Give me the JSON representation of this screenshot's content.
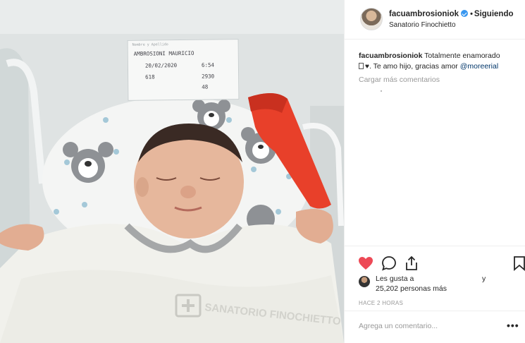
{
  "post": {
    "username": "facuambrosioniok",
    "follow_separator": "•",
    "follow_status": "Siguiendo",
    "location": "Sanatorio Finochietto",
    "caption": {
      "author": "facuambrosioniok",
      "text_1": "Totalmente enamorado",
      "text_2": ". Te amo hijo, gracias amor",
      "mention": "@moreerial"
    },
    "load_more_comments": "Cargar más comentarios",
    "likes": {
      "prefix": "Les gusta a",
      "and": "y",
      "count": "25,202 personas más"
    },
    "timestamp": "HACE 2 HORAS",
    "comment_placeholder": "Agrega un comentario...",
    "more_options": "•••"
  },
  "photo": {
    "blanket_text": "SANATORIO FINOCHIETTO",
    "card": {
      "name": "AMBROSIONI  MAURICIO",
      "date": "20/02/2020",
      "time": "6:54",
      "room": "618",
      "weight": "2930",
      "extra": "48"
    }
  },
  "icons": {
    "like": "heart-filled-icon",
    "comment": "comment-bubble-icon",
    "share": "share-upload-icon",
    "save": "bookmark-icon",
    "verified": "verified-badge-icon"
  },
  "colors": {
    "like_red": "#ed4956",
    "verified_blue": "#3897f0",
    "mention_blue": "#003569",
    "muted_gray": "#999999"
  }
}
